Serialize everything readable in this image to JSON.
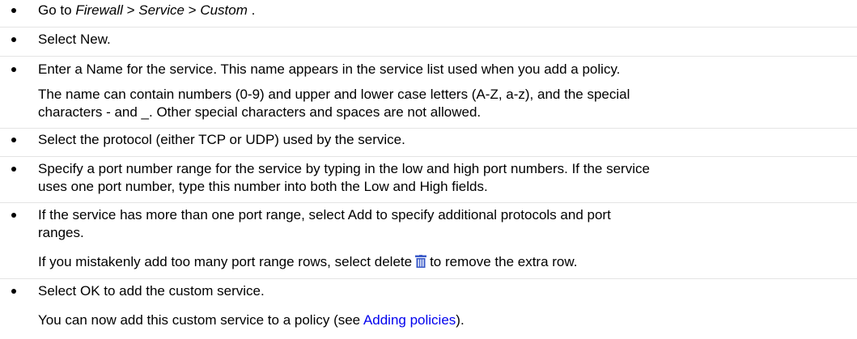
{
  "steps": [
    {
      "prefix": "Go to ",
      "path_1": "Firewall",
      "sep_1": " > ",
      "path_2": "Service",
      "sep_2": " > ",
      "path_3": "Custom",
      "suffix": " ."
    },
    {
      "text": "Select New."
    },
    {
      "line_1": "Enter a Name for the service. This name appears in the service list used when you add a policy.",
      "line_2": "The name can contain numbers (0-9) and upper and lower case letters (A-Z, a-z), and the special",
      "line_3": "characters - and _. Other special characters and spaces are not allowed."
    },
    {
      "text": "Select the protocol (either TCP or UDP) used by the service."
    },
    {
      "line_1": "Specify a port number range for the service by typing in the low and high port numbers. If the service",
      "line_2": "uses one port number, type this number into both the Low and High fields."
    },
    {
      "line_1": "If the service has more than one port range, select Add to specify additional protocols and port",
      "line_2": "ranges.",
      "line_3_before": "If you mistakenly add too many port range rows, select delete",
      "icon": "trash-icon",
      "line_3_after": "to remove the extra row."
    },
    {
      "line_1": "Select OK to add the custom service.",
      "line_2_before": "You can now add this custom service to a policy (see ",
      "link": "Adding policies",
      "line_2_after": ")."
    }
  ],
  "colors": {
    "text": "#000000",
    "link": "#0000ee",
    "icon": "#3b5bc8",
    "separator": "#e4e4e4"
  }
}
